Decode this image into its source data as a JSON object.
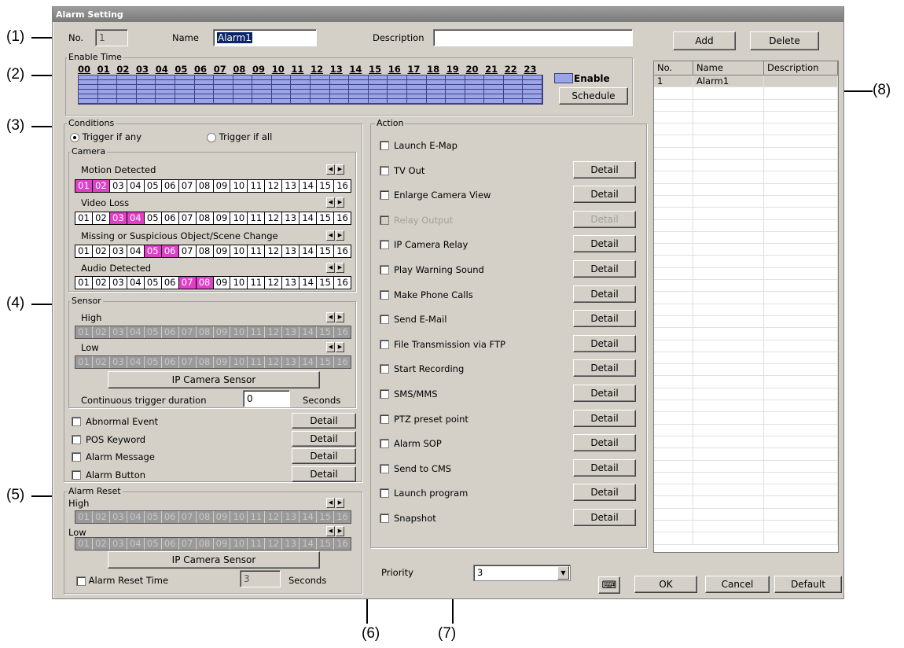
{
  "window": {
    "title": "Alarm Setting"
  },
  "top": {
    "no_label": "No.",
    "no_value": "1",
    "name_label": "Name",
    "name_value": "Alarm1",
    "desc_label": "Description",
    "desc_value": "",
    "add": "Add",
    "delete": "Delete"
  },
  "enable_time": {
    "label": "Enable Time",
    "hours": [
      "00",
      "01",
      "02",
      "03",
      "04",
      "05",
      "06",
      "07",
      "08",
      "09",
      "10",
      "11",
      "12",
      "13",
      "14",
      "15",
      "16",
      "17",
      "18",
      "19",
      "20",
      "21",
      "22",
      "23"
    ],
    "legend": "Enable",
    "schedule": "Schedule"
  },
  "conditions": {
    "label": "Conditions",
    "trigger_any": "Trigger if any",
    "trigger_all": "Trigger if all",
    "camera_label": "Camera",
    "channels": [
      "01",
      "02",
      "03",
      "04",
      "05",
      "06",
      "07",
      "08",
      "09",
      "10",
      "11",
      "12",
      "13",
      "14",
      "15",
      "16"
    ],
    "motion": {
      "label": "Motion Detected",
      "selected": [
        "01",
        "02"
      ]
    },
    "video_loss": {
      "label": "Video Loss",
      "selected": [
        "03",
        "04"
      ]
    },
    "missing": {
      "label": "Missing or Suspicious Object/Scene Change",
      "selected": [
        "05",
        "06"
      ]
    },
    "audio": {
      "label": "Audio Detected",
      "selected": [
        "07",
        "08"
      ]
    },
    "sensor_label": "Sensor",
    "high": "High",
    "low": "Low",
    "ip_camera_sensor": "IP Camera Sensor",
    "duration_label": "Continuous trigger duration",
    "duration_value": "0",
    "seconds": "Seconds",
    "events": [
      {
        "label": "Abnormal Event",
        "detail": "Detail"
      },
      {
        "label": "POS Keyword",
        "detail": "Detail"
      },
      {
        "label": "Alarm Message",
        "detail": "Detail"
      },
      {
        "label": "Alarm Button",
        "detail": "Detail"
      }
    ]
  },
  "alarm_reset": {
    "label": "Alarm Reset",
    "high": "High",
    "low": "Low",
    "ip_camera_sensor": "IP Camera Sensor",
    "reset_time_label": "Alarm Reset Time",
    "reset_time_value": "3",
    "seconds": "Seconds"
  },
  "action": {
    "label": "Action",
    "items": [
      {
        "label": "Launch E-Map",
        "detail": "",
        "disabled": false
      },
      {
        "label": "TV Out",
        "detail": "Detail",
        "disabled": false
      },
      {
        "label": "Enlarge Camera View",
        "detail": "Detail",
        "disabled": false
      },
      {
        "label": "Relay Output",
        "detail": "Detail",
        "disabled": true
      },
      {
        "label": "IP Camera Relay",
        "detail": "Detail",
        "disabled": false
      },
      {
        "label": "Play Warning Sound",
        "detail": "Detail",
        "disabled": false
      },
      {
        "label": "Make Phone Calls",
        "detail": "Detail",
        "disabled": false
      },
      {
        "label": "Send E-Mail",
        "detail": "Detail",
        "disabled": false
      },
      {
        "label": "File Transmission via FTP",
        "detail": "Detail",
        "disabled": false
      },
      {
        "label": "Start Recording",
        "detail": "Detail",
        "disabled": false
      },
      {
        "label": "SMS/MMS",
        "detail": "Detail",
        "disabled": false
      },
      {
        "label": "PTZ preset point",
        "detail": "Detail",
        "disabled": false
      },
      {
        "label": "Alarm SOP",
        "detail": "Detail",
        "disabled": false
      },
      {
        "label": "Send to CMS",
        "detail": "Detail",
        "disabled": false
      },
      {
        "label": "Launch program",
        "detail": "Detail",
        "disabled": false
      },
      {
        "label": "Snapshot",
        "detail": "Detail",
        "disabled": false
      }
    ]
  },
  "priority": {
    "label": "Priority",
    "value": "3"
  },
  "list": {
    "headers": [
      "No.",
      "Name",
      "Description"
    ],
    "rows": [
      {
        "no": "1",
        "name": "Alarm1",
        "desc": ""
      }
    ]
  },
  "bottom": {
    "ok": "OK",
    "cancel": "Cancel",
    "default": "Default",
    "keyboard_icon": "keyboard-icon"
  },
  "annotations": [
    "(1)",
    "(2)",
    "(3)",
    "(4)",
    "(5)",
    "(6)",
    "(7)",
    "(8)"
  ]
}
